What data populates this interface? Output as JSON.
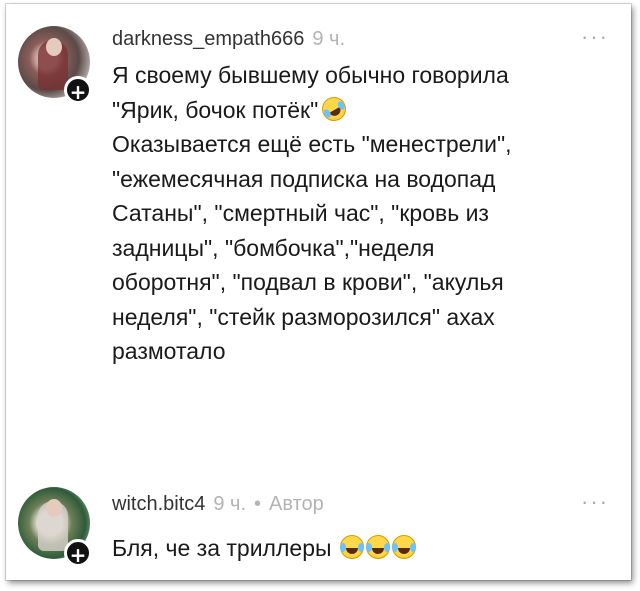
{
  "comments": [
    {
      "username": "darkness_empath666",
      "time": "9 ч.",
      "more": "···",
      "text": "Я своему бывшему обычно говорила\n\"Ярик, бочок потёк\"",
      "text_rest": "Оказывается ещё есть \"менестрели\",\n\"ежемесячная подписка на водопад\nСатаны\", \"смертный час\", \"кровь из\nзадницы\", \"бомбочка\",\"неделя\nоборотня\", \"подвал в крови\", \"акулья\nнеделя\", \"стейк разморозился\" ахах\nразмотало",
      "emoji": "rolling-on-floor-laughing"
    },
    {
      "username": "witch.bitc4",
      "time": "9 ч.",
      "separator": "•",
      "badge": "Автор",
      "more": "···",
      "text": "Бля, че за триллеры",
      "emoji": "tears-of-joy x3"
    }
  ],
  "follow_symbol": "+"
}
